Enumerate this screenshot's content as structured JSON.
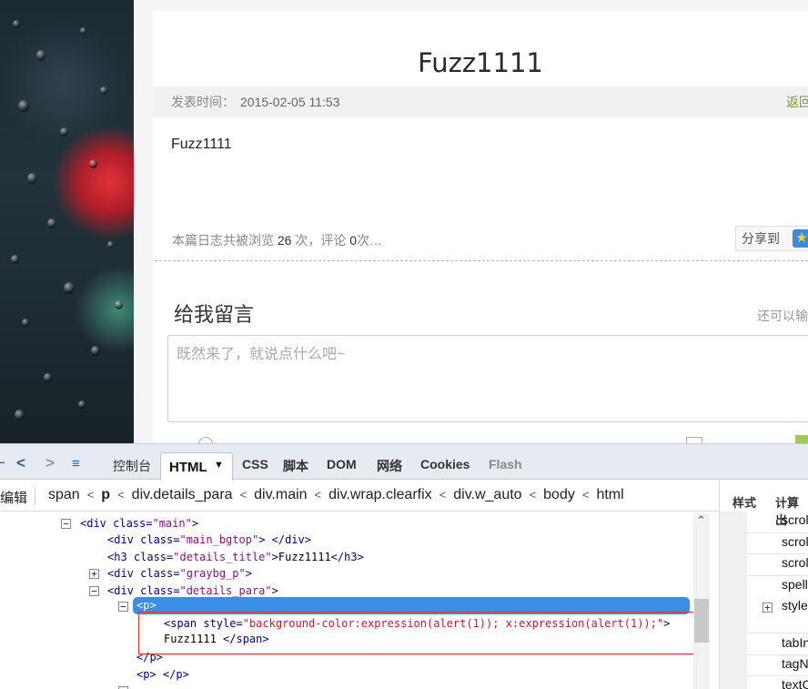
{
  "post": {
    "title": "Fuzz1111",
    "date_label": "发表时间：",
    "date": "2015-02-05 11:53",
    "back_link": "返回",
    "body": "Fuzz1111",
    "stats_prefix": "本篇日志共被浏览",
    "views": "26",
    "stats_mid1": "次，评论",
    "comments": "0",
    "stats_suffix": "次…",
    "share_label": "分享到"
  },
  "comment_form": {
    "title": "给我留言",
    "hint": "还可以输",
    "placeholder": "既然来了，就说点什么吧~"
  },
  "devtools": {
    "tabs": [
      "控制台",
      "HTML",
      "CSS",
      "脚本",
      "DOM",
      "网络",
      "Cookies",
      "Flash"
    ],
    "active_tab": "HTML",
    "edit_label": "编辑",
    "breadcrumbs": [
      "span",
      "p",
      "div.details_para",
      "div.main",
      "div.wrap.clearfix",
      "div.w_auto",
      "body",
      "html"
    ],
    "side_tabs": [
      "样式",
      "计算出"
    ],
    "side_props": [
      "scroll",
      "scroll",
      "scroll",
      "spello",
      "style",
      "tabIn",
      "tagNa",
      "textC"
    ],
    "tree": {
      "n1_tag": "<div ",
      "n1_an": "class=",
      "n1_av": "\"main\"",
      "n1_end": ">",
      "n2_tag": "<div ",
      "n2_an": "class=",
      "n2_av": "\"main_bgtop\"",
      "n2_end": "> </div>",
      "n3_tag": "<h3 ",
      "n3_an": "class=",
      "n3_av": "\"details_title\"",
      "n3_mid": ">",
      "n3_txt": "Fuzz1111",
      "n3_end": "</h3>",
      "n4_tag": "<div ",
      "n4_an": "class=",
      "n4_av": "\"graybg_p\"",
      "n4_end": ">",
      "n5_tag": "<div ",
      "n5_an": "class=",
      "n5_av": "\"details_para\"",
      "n5_end": ">",
      "sel": "<p>",
      "span_tag": "<span ",
      "span_an": "style=",
      "span_av": "\"background-color:expression(alert(1)); x:expression(alert(1));\"",
      "span_end": ">",
      "span_txt": "Fuzz1111 ",
      "span_close": "</span>",
      "p_close": "</p>",
      "p2": "<p>  </p>",
      "last": "<p>"
    }
  }
}
